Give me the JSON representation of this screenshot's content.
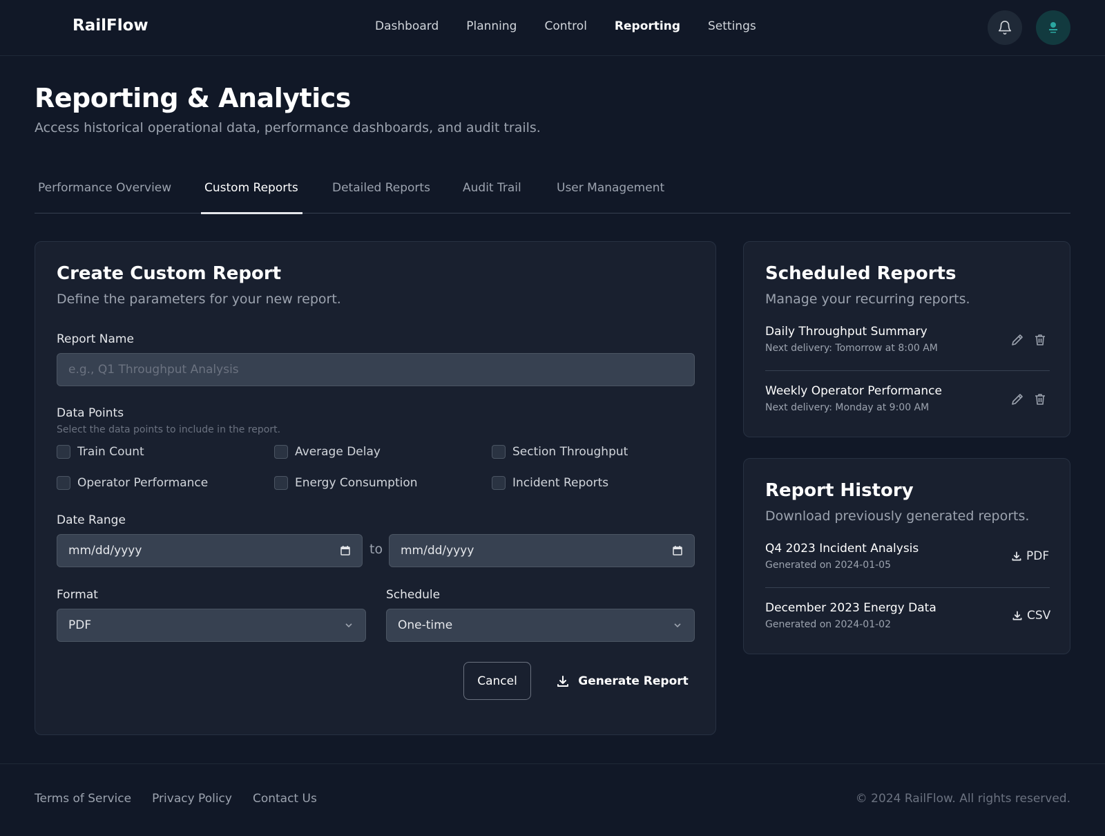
{
  "app": {
    "brand": "RailFlow"
  },
  "nav": {
    "items": [
      {
        "label": "Dashboard"
      },
      {
        "label": "Planning"
      },
      {
        "label": "Control"
      },
      {
        "label": "Reporting",
        "active": true
      },
      {
        "label": "Settings"
      }
    ],
    "icons": {
      "notifications": "bell-icon",
      "avatar": "user-avatar"
    }
  },
  "page": {
    "title": "Reporting & Analytics",
    "subtitle": "Access historical operational data, performance dashboards, and audit trails."
  },
  "tabs": [
    {
      "label": "Performance Overview"
    },
    {
      "label": "Custom Reports",
      "active": true
    },
    {
      "label": "Detailed Reports"
    },
    {
      "label": "Audit Trail"
    },
    {
      "label": "User Management"
    }
  ],
  "create_report": {
    "title": "Create Custom Report",
    "subtitle": "Define the parameters for your new report.",
    "report_name": {
      "label": "Report Name",
      "placeholder": "e.g., Q1 Throughput Analysis",
      "value": ""
    },
    "data_points": {
      "label": "Data Points",
      "hint": "Select the data points to include in the report.",
      "options": [
        {
          "label": "Train Count",
          "checked": false
        },
        {
          "label": "Average Delay",
          "checked": false
        },
        {
          "label": "Section Throughput",
          "checked": false
        },
        {
          "label": "Operator Performance",
          "checked": false
        },
        {
          "label": "Energy Consumption",
          "checked": false
        },
        {
          "label": "Incident Reports",
          "checked": false
        }
      ]
    },
    "date_range": {
      "label": "Date Range",
      "start_placeholder": "mm/dd/yyyy",
      "separator": "to",
      "end_placeholder": "mm/dd/yyyy"
    },
    "format": {
      "label": "Format",
      "value": "PDF"
    },
    "schedule": {
      "label": "Schedule",
      "value": "One-time"
    },
    "actions": {
      "cancel": "Cancel",
      "generate": "Generate Report"
    }
  },
  "scheduled_reports": {
    "title": "Scheduled Reports",
    "subtitle": "Manage your recurring reports.",
    "items": [
      {
        "name": "Daily Throughput Summary",
        "meta": "Next delivery: Tomorrow at 8:00 AM"
      },
      {
        "name": "Weekly Operator Performance",
        "meta": "Next delivery: Monday at 9:00 AM"
      }
    ]
  },
  "report_history": {
    "title": "Report History",
    "subtitle": "Download previously generated reports.",
    "items": [
      {
        "name": "Q4 2023 Incident Analysis",
        "meta": "Generated on 2024-01-05",
        "download": "PDF"
      },
      {
        "name": "December 2023 Energy Data",
        "meta": "Generated on 2024-01-02",
        "download": "CSV"
      }
    ]
  },
  "footer": {
    "links": [
      "Terms of Service",
      "Privacy Policy",
      "Contact Us"
    ],
    "copyright": "© 2024 RailFlow. All rights reserved."
  },
  "colors": {
    "background": "#111827",
    "card": "#19202f",
    "input": "#374151",
    "text_primary": "#ffffff",
    "text_muted": "#9ca3af"
  }
}
